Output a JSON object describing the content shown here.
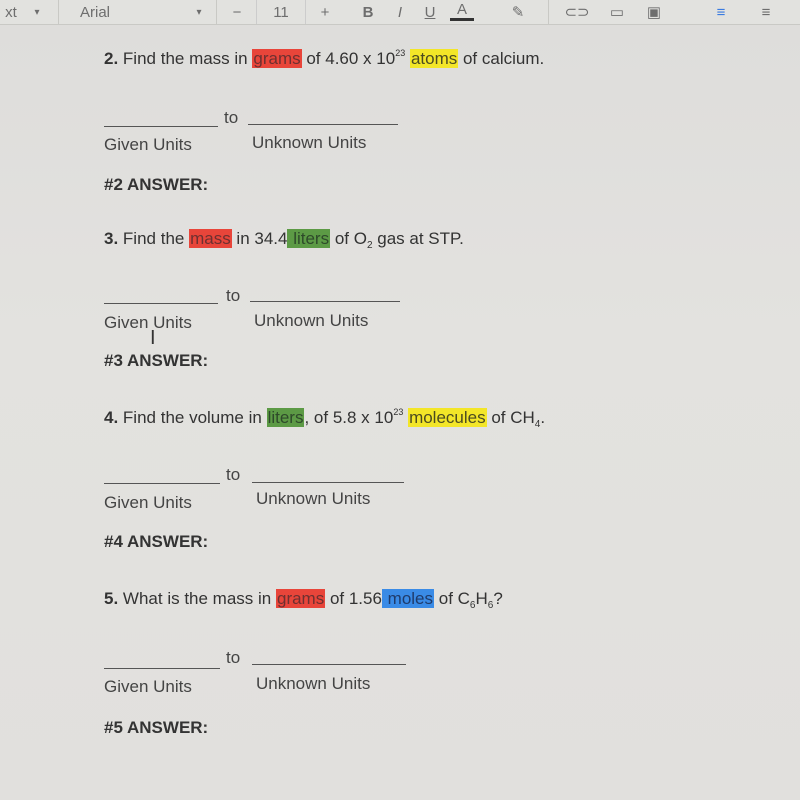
{
  "toolbar": {
    "style_label": "xt",
    "font_name": "Arial",
    "font_size": "11",
    "decrease_label": "−",
    "increase_label": "+",
    "bold": "B",
    "italic": "I",
    "underline": "U",
    "text_color": "A"
  },
  "questions": [
    {
      "number": "2.",
      "parts": [
        "Find the mass in ",
        "grams",
        " of 4.60 x 10",
        "23",
        " ",
        "atoms",
        " of calcium."
      ],
      "to": "to",
      "given": "Given Units",
      "unknown": "Unknown Units",
      "answer": "#2 ANSWER:"
    },
    {
      "number": "3.",
      "parts": [
        "Find the ",
        "mass",
        " in 34.4",
        " liters",
        " of O",
        "2",
        " gas at STP."
      ],
      "to": "to",
      "given": "Given Units",
      "unknown": "Unknown Units",
      "answer": "#3 ANSWER:"
    },
    {
      "number": "4.",
      "parts": [
        "Find the volume in ",
        "liters",
        ", of 5.8 x 10",
        "23",
        " ",
        "molecules",
        " of CH",
        "4",
        "."
      ],
      "to": "to",
      "given": "Given Units",
      "unknown": "Unknown Units",
      "answer": "#4 ANSWER:"
    },
    {
      "number": "5.",
      "parts": [
        "What is the mass in ",
        "grams",
        " of 1.56",
        " moles",
        " of C",
        "6",
        "H",
        "6",
        "?"
      ],
      "to": "to",
      "given": "Given Units",
      "unknown": "Unknown Units",
      "answer": "#5 ANSWER:"
    }
  ],
  "colors": {
    "highlight_red": "#e8453a",
    "highlight_yellow": "#f3e628",
    "highlight_green": "#5c9a45",
    "highlight_blue": "#3a8be6"
  }
}
